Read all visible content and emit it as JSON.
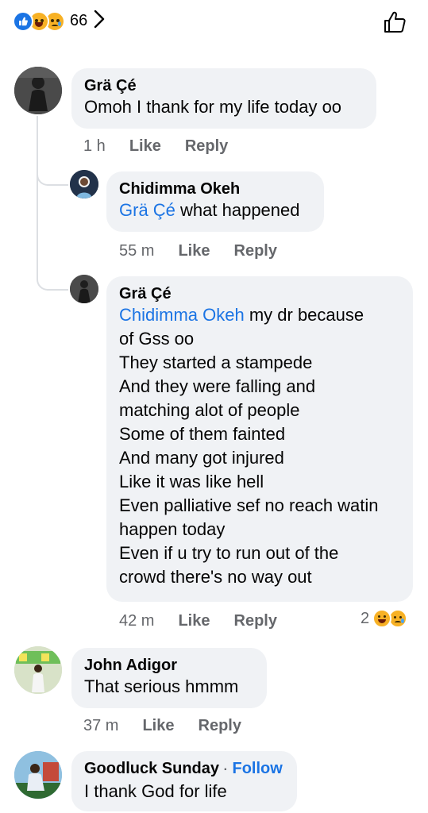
{
  "header": {
    "reaction_count": "66",
    "reactions": [
      "like",
      "haha",
      "sad"
    ]
  },
  "comments": [
    {
      "author": "Grä Çé",
      "text": "Omoh I thank for my life today oo",
      "time": "1 h",
      "like": "Like",
      "reply": "Reply"
    },
    {
      "author": "Chidimma Okeh",
      "mention": "Grä Çé",
      "text": " what happened",
      "time": "55 m",
      "like": "Like",
      "reply": "Reply"
    },
    {
      "author": "Grä Çé",
      "mention": "Chidimma Okeh",
      "lines": [
        " my dr because",
        "of Gss oo",
        "They started a stampede",
        "And they were falling and",
        "matching alot of people",
        "Some of them fainted",
        "And many got injured",
        "Like it was like hell",
        "Even palliative sef no reach watin",
        "happen today",
        "Even if u try to run out of the",
        "crowd there's no way out"
      ],
      "time": "42 m",
      "like": "Like",
      "reply": "Reply",
      "reaction_count": "2"
    },
    {
      "author": "John Adigor",
      "text": "That serious hmmm",
      "time": "37 m",
      "like": "Like",
      "reply": "Reply"
    },
    {
      "author": "Goodluck Sunday",
      "follow": "Follow",
      "separator": "·",
      "text": "I thank God for life"
    }
  ],
  "colors": {
    "bubble": "#f0f2f5",
    "link": "#1b74e4",
    "meta": "#65676b"
  }
}
